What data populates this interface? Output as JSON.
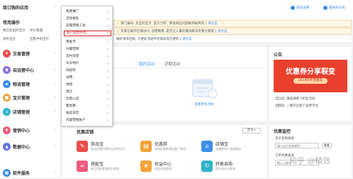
{
  "sidebar": {
    "my_apps": "我订购的应用",
    "common_ops": "常用操作",
    "links": [
      "我已卖出的宝贝",
      "评价管理",
      "发布宝贝",
      "出售中的宝贝"
    ],
    "categories": [
      {
        "label": "交易管理",
        "color": "#e94d4d"
      },
      {
        "label": "自运营中心",
        "color": "#8a6dd6"
      },
      {
        "label": "物流管理",
        "color": "#3d8ee6"
      },
      {
        "label": "宝贝管理",
        "color": "#f2a33a"
      },
      {
        "label": "店铺管理",
        "color": "#2fb1c9"
      },
      {
        "label": "营销中心",
        "color": "#ee5b7a"
      },
      {
        "label": "数据中心",
        "color": "#5c6ee8"
      },
      {
        "label": "软件服务",
        "color": "#3d8ee6"
      }
    ]
  },
  "menu": {
    "items": [
      "我要推广",
      "活动报名",
      "店铺营销工具",
      "客户运营平台",
      "用金币",
      "兴趣营销",
      "农村淘宝",
      "天天特价",
      "淘抢购",
      "试用",
      "拼团",
      "清仓",
      "淘宝心选",
      "聚划算",
      "拍卖日历",
      "内容营销账户"
    ],
    "active_index": 3
  },
  "header": {
    "link1": "提现去哪",
    "link2": "相关的在线",
    "notice1": "部门编号: 卖出的宝贝, 官方力荐 , 降低商品问题被举报风险 |",
    "notice1_link": "请点击",
    "notice2": "卖家已被开启请访问, 创建数量, 是否让入最优最快解决及重大期望 |",
    "notice2_link": "请点击",
    "notice3": "做好请求回执, 方便此活动中店铺表现方便的 |",
    "notice3_link": "请点击"
  },
  "tabs": {
    "tab1": "我的活动",
    "tab2": "近期活动"
  },
  "activity": {
    "more_link": "查看更多活动"
  },
  "tools": {
    "title": "优惠店铺",
    "button": "更多+",
    "cards": [
      {
        "name": "单品宝",
        "desc": "商品优惠设置单品多种折扣",
        "color": "#e94d4d",
        "icon": "tag-icon"
      },
      {
        "name": "优惠券",
        "desc": "多种优惠券满足推广需求",
        "color": "#f2a33a",
        "icon": "ticket-icon"
      },
      {
        "name": "店铺宝",
        "desc": "店铺营销工具满减送",
        "color": "#3d8ee6",
        "icon": "shop-icon"
      },
      {
        "name": "搭配宝",
        "desc": "商品搭配套餐提升客单",
        "color": "#ee5b7a",
        "icon": "link-icon"
      },
      {
        "name": "权益中心",
        "desc": "权益投放管理",
        "color": "#f2a33a",
        "icon": "gift-icon"
      },
      {
        "name": "转换自购",
        "desc": "提升转化与复购",
        "color": "#2fb1c9",
        "icon": "cycle-icon"
      }
    ]
  },
  "announcement": {
    "title": "公告",
    "banner_title": "优惠券分享裂变",
    "banner_sub": "2019的专营赛道",
    "lines": [
      "【互动】满减满赠 5折起活动",
      "【重磅】一键开启客户运营平台"
    ]
  },
  "right_panel": {
    "title": "优惠监控",
    "field1_label": "宝贝名称搜索",
    "field1_placeholder": "输入宝贝名称或ID",
    "field2_label": "订单优惠查询",
    "field2_placeholder": "输入订单号",
    "link": "查看"
  },
  "watermark": "知乎 @精效"
}
